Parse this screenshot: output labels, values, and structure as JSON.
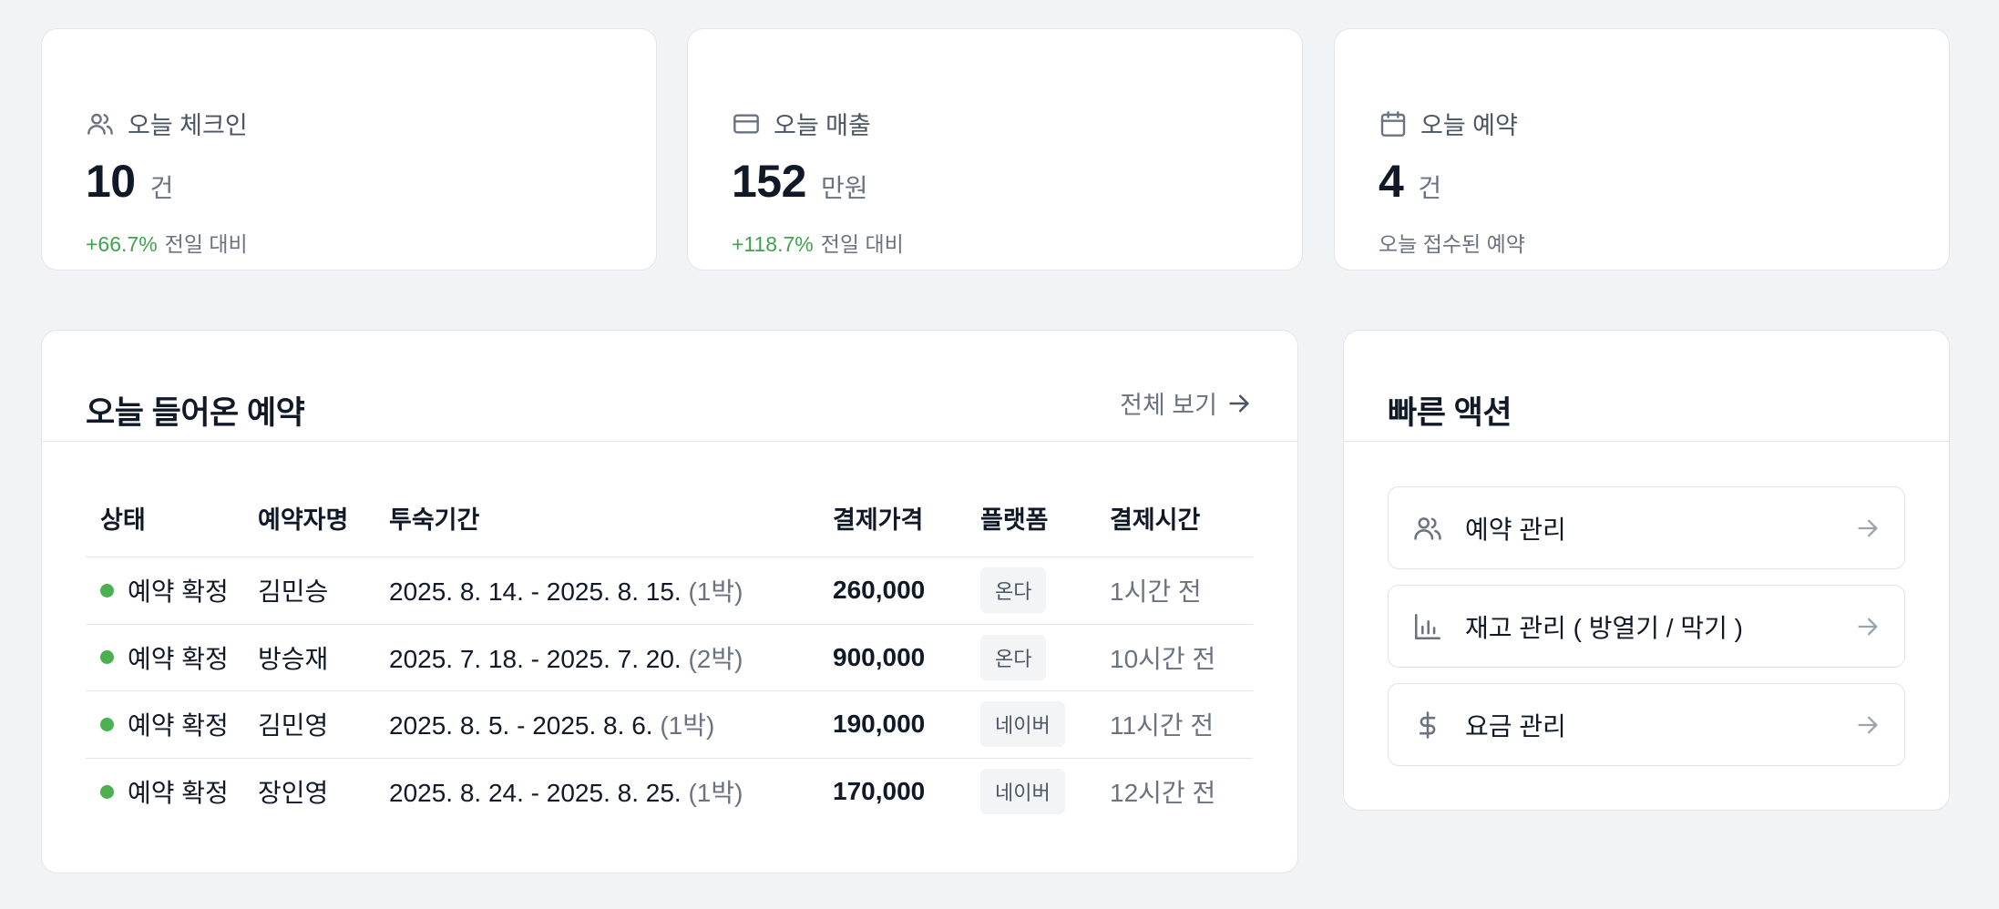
{
  "stats": [
    {
      "icon": "users-icon",
      "title": "오늘 체크인",
      "value": "10",
      "unit": "건",
      "delta": "+66.7%",
      "sub": "전일 대비"
    },
    {
      "icon": "credit-card-icon",
      "title": "오늘 매출",
      "value": "152",
      "unit": "만원",
      "delta": "+118.7%",
      "sub": "전일 대비"
    },
    {
      "icon": "calendar-icon",
      "title": "오늘 예약",
      "value": "4",
      "unit": "건",
      "delta": "",
      "sub": "오늘 접수된 예약"
    }
  ],
  "reservations": {
    "title": "오늘 들어온 예약",
    "view_all": "전체 보기",
    "columns": [
      "상태",
      "예약자명",
      "투숙기간",
      "결제가격",
      "플랫폼",
      "결제시간"
    ],
    "rows": [
      {
        "status": "예약 확정",
        "name": "김민승",
        "period": "2025. 8. 14. - 2025. 8. 15.",
        "nights": "(1박)",
        "price": "260,000",
        "platform": "온다",
        "time": "1시간 전"
      },
      {
        "status": "예약 확정",
        "name": "방승재",
        "period": "2025. 7. 18. - 2025. 7. 20.",
        "nights": "(2박)",
        "price": "900,000",
        "platform": "온다",
        "time": "10시간 전"
      },
      {
        "status": "예약 확정",
        "name": "김민영",
        "period": "2025. 8. 5. - 2025. 8. 6.",
        "nights": "(1박)",
        "price": "190,000",
        "platform": "네이버",
        "time": "11시간 전"
      },
      {
        "status": "예약 확정",
        "name": "장인영",
        "period": "2025. 8. 24. - 2025. 8. 25.",
        "nights": "(1박)",
        "price": "170,000",
        "platform": "네이버",
        "time": "12시간 전"
      }
    ]
  },
  "quick_actions": {
    "title": "빠른 액션",
    "items": [
      {
        "icon": "users-icon",
        "label": "예약 관리"
      },
      {
        "icon": "bar-chart-icon",
        "label": "재고 관리 ( 방열기 / 막기 )"
      },
      {
        "icon": "dollar-icon",
        "label": "요금 관리"
      }
    ]
  },
  "colors": {
    "positive": "#3fa34d",
    "status_dot": "#4caf50",
    "background": "#f2f3f5"
  }
}
